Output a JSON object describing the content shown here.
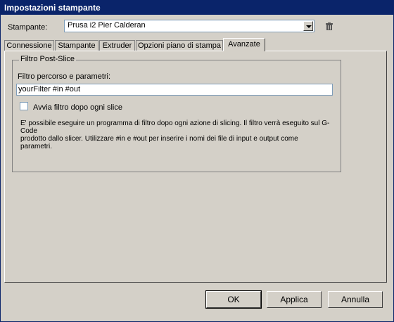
{
  "window": {
    "title": "Impostazioni stampante"
  },
  "printer": {
    "label": "Stampante:",
    "selected": "Prusa i2 Pier Calderan",
    "delete_icon": "trash-icon"
  },
  "tabs": [
    {
      "label": "Connessione"
    },
    {
      "label": "Stampante"
    },
    {
      "label": "Extruder"
    },
    {
      "label": "Opzioni piano di stampa"
    },
    {
      "label": "Avanzate",
      "active": true
    }
  ],
  "post_slice": {
    "group_title": "Filtro Post-Slice",
    "field_label": "Filtro percorso e parametri:",
    "field_value": "yourFilter #in #out",
    "checkbox_label": "Avvia filtro dopo ogni slice",
    "checkbox_checked": false,
    "description": "E' possibile eseguire un programma di filtro dopo ogni azione di slicing. Il filtro verrà eseguito sul G-Code\nprodotto dallo slicer. Utilizzare #in e #out per inserire i nomi dei file di input e output come parametri."
  },
  "buttons": {
    "ok": "OK",
    "apply": "Applica",
    "cancel": "Annulla"
  }
}
